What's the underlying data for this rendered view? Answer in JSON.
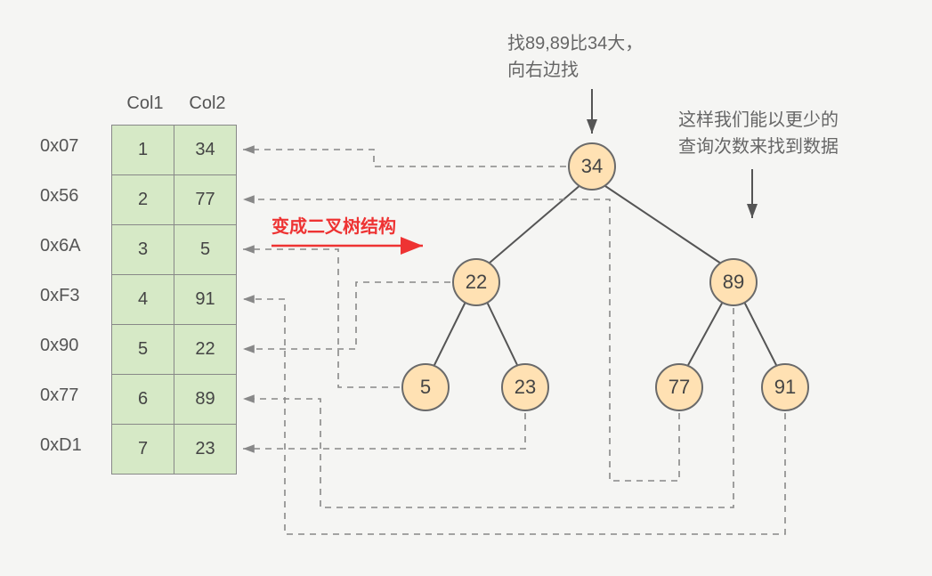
{
  "headers": {
    "col1": "Col1",
    "col2": "Col2"
  },
  "rows": [
    {
      "addr": "0x07",
      "c1": "1",
      "c2": "34"
    },
    {
      "addr": "0x56",
      "c1": "2",
      "c2": "77"
    },
    {
      "addr": "0x6A",
      "c1": "3",
      "c2": "5"
    },
    {
      "addr": "0xF3",
      "c1": "4",
      "c2": "91"
    },
    {
      "addr": "0x90",
      "c1": "5",
      "c2": "22"
    },
    {
      "addr": "0x77",
      "c1": "6",
      "c2": "89"
    },
    {
      "addr": "0xD1",
      "c1": "7",
      "c2": "23"
    }
  ],
  "tree": {
    "root": "34",
    "l": "22",
    "r": "89",
    "ll": "5",
    "lr": "23",
    "rl": "77",
    "rr": "91"
  },
  "annotations": {
    "top1_line1": "找89,89比34大，",
    "top1_line2": "向右边找",
    "top2_line1": "这样我们能以更少的",
    "top2_line2": "查询次数来找到数据",
    "red": "变成二叉树结构"
  }
}
